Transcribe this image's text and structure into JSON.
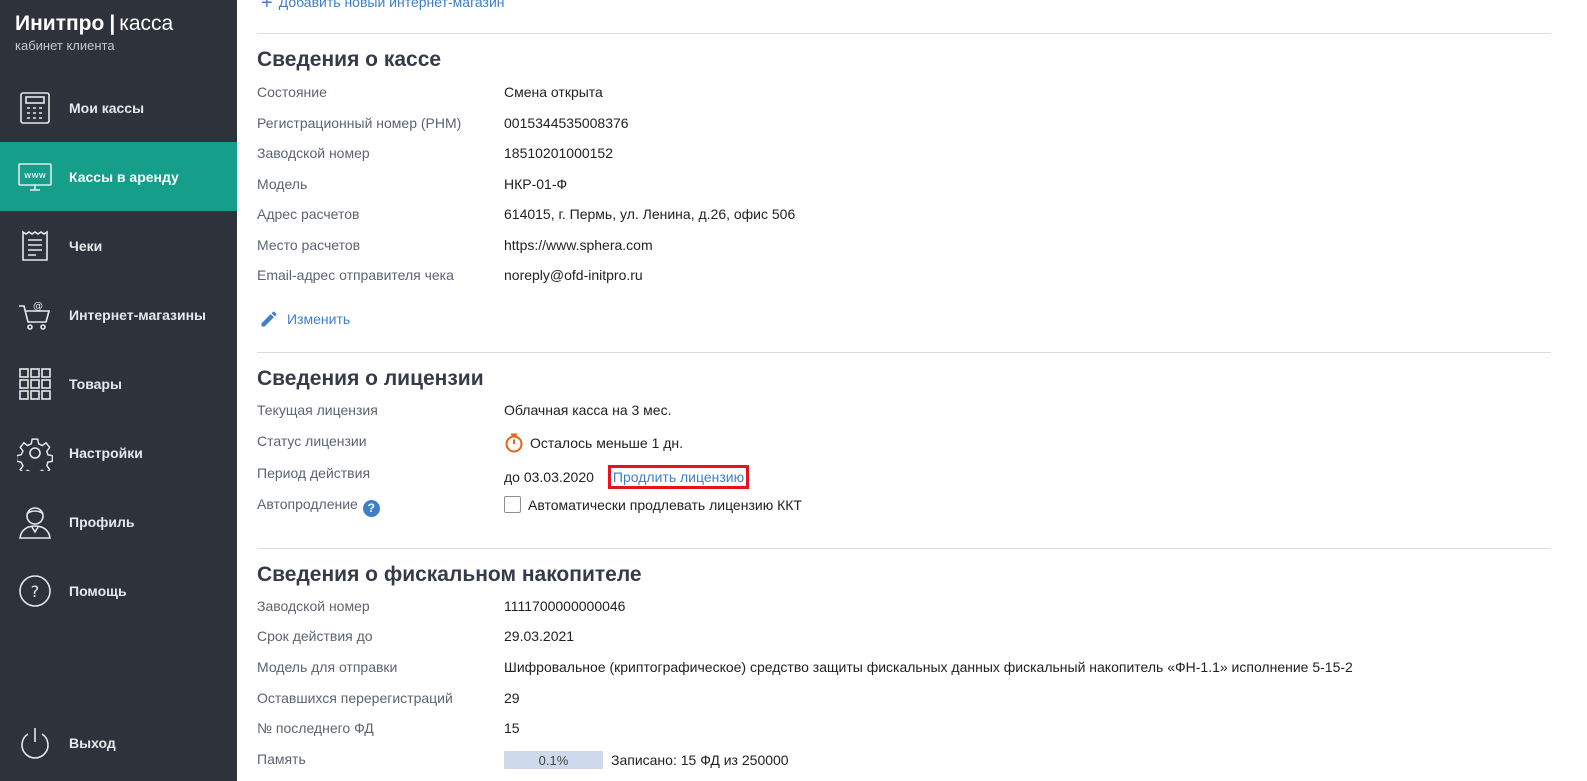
{
  "brand": {
    "name": "Инитпро",
    "product": "касса",
    "subtitle": "кабинет клиента"
  },
  "sidebar": {
    "items": [
      {
        "label": "Мои кассы",
        "icon": "cash-register-icon"
      },
      {
        "label": "Кассы в аренду",
        "icon": "www-monitor-icon",
        "active": true
      },
      {
        "label": "Чеки",
        "icon": "receipt-icon"
      },
      {
        "label": "Интернет-магазины",
        "icon": "cart-icon"
      },
      {
        "label": "Товары",
        "icon": "grid-icon"
      },
      {
        "label": "Настройки",
        "icon": "gear-icon"
      },
      {
        "label": "Профиль",
        "icon": "user-icon"
      },
      {
        "label": "Помощь",
        "icon": "help-icon"
      }
    ],
    "logout": {
      "label": "Выход",
      "icon": "power-icon"
    }
  },
  "main": {
    "add_shop": "Добавить новый интернет-магазин",
    "kassa": {
      "title": "Сведения о кассе",
      "rows": [
        {
          "label": "Состояние",
          "value": "Смена открыта"
        },
        {
          "label": "Регистрационный номер (РНМ)",
          "value": "0015344535008376"
        },
        {
          "label": "Заводской номер",
          "value": "18510201000152"
        },
        {
          "label": "Модель",
          "value": "НКР-01-Ф"
        },
        {
          "label": "Адрес расчетов",
          "value": "614015, г. Пермь, ул. Ленина, д.26, офис 506"
        },
        {
          "label": "Место расчетов",
          "value": "https://www.sphera.com"
        },
        {
          "label": "Email-адрес отправителя чека",
          "value": "noreply@ofd-initpro.ru"
        }
      ],
      "edit_label": "Изменить"
    },
    "license": {
      "title": "Сведения о лицензии",
      "current_label": "Текущая лицензия",
      "current_value": "Облачная касса на 3 мес.",
      "status_label": "Статус лицензии",
      "status_value": "Осталось меньше 1 дн.",
      "period_label": "Период действия",
      "period_value": "до 03.03.2020",
      "renew_label": "Продлить лицензию",
      "auto_label": "Автопродление",
      "auto_help": "?",
      "auto_checkbox_label": "Автоматически продлевать лицензию ККТ",
      "auto_checked": false
    },
    "fn": {
      "title": "Сведения о фискальном накопителе",
      "rows": [
        {
          "label": "Заводской номер",
          "value": "1111700000000046"
        },
        {
          "label": "Срок действия до",
          "value": "29.03.2021"
        },
        {
          "label": "Модель для отправки",
          "value": "Шифровальное (криптографическое) средство защиты фискальных данных фискальный накопитель «ФН-1.1» исполнение 5-15-2"
        },
        {
          "label": "Оставшихся перерегистраций",
          "value": "29"
        },
        {
          "label": "№ последнего ФД",
          "value": "15"
        }
      ],
      "memory_label": "Память",
      "memory_percent": "0.1%",
      "memory_text": "Записано: 15 ФД из 250000"
    }
  },
  "colors": {
    "sidebar_bg": "#2e323b",
    "active_bg": "#159f8a",
    "link": "#3f7fc9",
    "highlight": "#e3141b",
    "timer": "#e8621c"
  }
}
